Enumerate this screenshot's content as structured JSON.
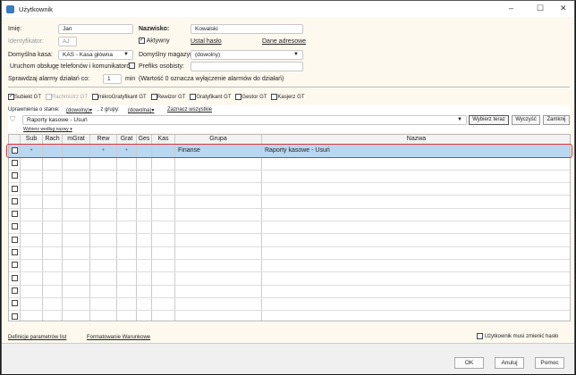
{
  "window": {
    "title": "Użytkownik"
  },
  "form": {
    "imie_label": "Imię:",
    "imie": "Jan",
    "nazwisko_label": "Nazwisko:",
    "nazwisko": "Kowalski",
    "identyfikator_label": "Identyfikator:",
    "identyfikator": "AJ",
    "aktywny_label": "Aktywny",
    "aktywny": true,
    "ustal_haslo": "Ustal hasło",
    "dane_adresowe": "Dane adresowe",
    "kasa_label": "Domyślna kasa:",
    "kasa": "KAS - Kasa główna",
    "magazyn_label": "Domyślny magazyn:",
    "magazyn": "(dowolny)",
    "telefony_label": "Uruchom obsługę telefonów i komunikatorów",
    "prefiks_label": "Prefiks osobisty:",
    "prefiks": "",
    "alarmy_label": "Sprawdzaj alarmy działań co:",
    "alarmy": "1",
    "min": "min",
    "alarmy_note": "(Wartość 0 oznacza wyłączenie alarmów do działań)"
  },
  "modules": [
    {
      "label": "Subiekt GT",
      "checked": true,
      "disabled": false
    },
    {
      "label": "Rachmistrz GT",
      "checked": false,
      "disabled": true
    },
    {
      "label": "mikroGratyfikant GT",
      "checked": false,
      "disabled": false
    },
    {
      "label": "Rewizor GT",
      "checked": false,
      "disabled": false
    },
    {
      "label": "Gratyfikant GT",
      "checked": false,
      "disabled": false
    },
    {
      "label": "Gestor GT",
      "checked": false,
      "disabled": false
    },
    {
      "label": "Kasjerz GT",
      "checked": false,
      "disabled": false
    }
  ],
  "filter": {
    "stan_label": "Uprawnienia o stanie:",
    "stan": "(dowolny)",
    "grupa_label": ", z grupy:",
    "grupa": "(dowolna)",
    "zaznacz": "Zaznacz wszystkie",
    "search": "Raporty kasowe - Usuń",
    "wybierz_wg": "Wybierz według nazwy",
    "wybierz_teraz": "Wybierz teraz",
    "wyczysc": "Wyczyść",
    "zamknij": "Zamknij"
  },
  "grid": {
    "columns": [
      "Sub",
      "Rach",
      "mGrat",
      "Rew",
      "Grat",
      "Ges",
      "Kas",
      "Grupa",
      "Nazwa"
    ],
    "rows": [
      {
        "sub": "•",
        "rach": "",
        "mgrat": "",
        "rew": "•",
        "grat": "•",
        "ges": "",
        "kas": "",
        "grupa": "Finanse",
        "nazwa": "Raporty kasowe - Usuń"
      }
    ]
  },
  "footer": {
    "definicje": "Definicje parametrów list",
    "formatowanie": "Formatowanie Warunkowe",
    "musi_zmienic": "Użytkownik musi zmienić hasło",
    "ok": "OK",
    "anuluj": "Anuluj",
    "pomoc": "Pomoc"
  }
}
